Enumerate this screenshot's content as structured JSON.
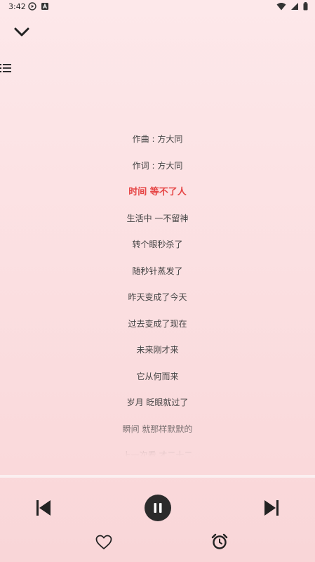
{
  "status_bar": {
    "time": "3:42"
  },
  "lyrics": {
    "current_index": 2,
    "lines": [
      "作曲 : 方大同",
      "作词 : 方大同",
      "时间 等不了人",
      "生活中 一不留神",
      "转个眼秒杀了",
      "随秒针蒸发了",
      "昨天变成了今天",
      "过去变成了现在",
      "未来刚才来",
      "它从何而来",
      "岁月 眨眼就过了",
      "瞬间 就那样默默的",
      "上一次看 才二十二"
    ]
  },
  "colors": {
    "accent": "#e64545",
    "background_top": "#fde8ea",
    "background_bottom": "#f9d6d8",
    "control": "#2b2b2b"
  },
  "icons": {
    "collapse": "chevron-down-icon",
    "playlist": "playlist-icon",
    "previous": "skip-previous-icon",
    "pause": "pause-icon",
    "next": "skip-next-icon",
    "favorite": "heart-outline-icon",
    "alarm": "alarm-clock-icon"
  }
}
